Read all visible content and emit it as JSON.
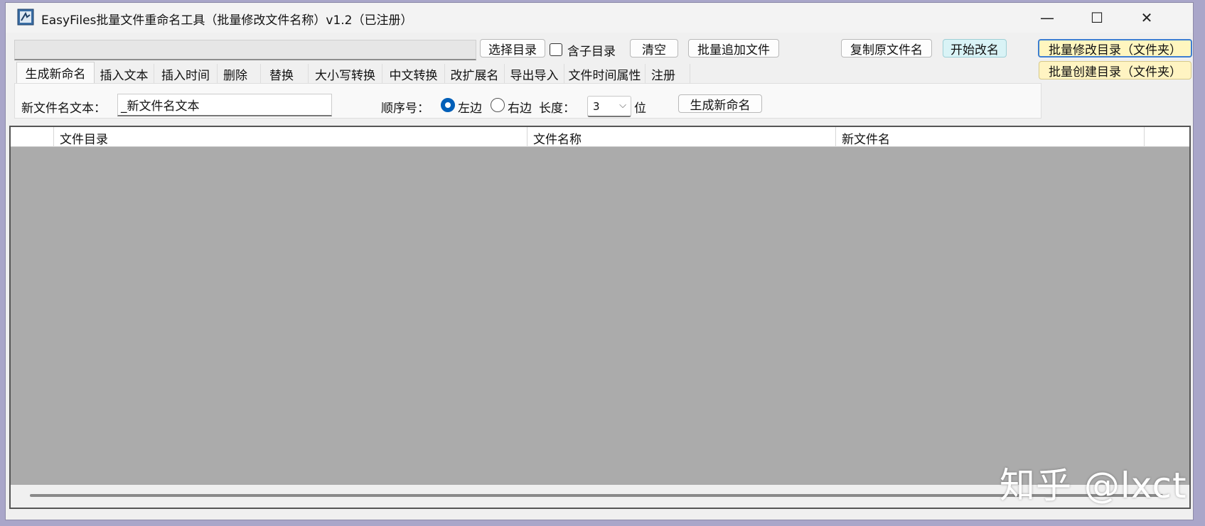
{
  "window": {
    "title": "EasyFiles批量文件重命名工具（批量修改文件名称）v1.2（已注册）",
    "minimize_glyph": "—",
    "maximize_glyph": "☐",
    "close_glyph": "✕"
  },
  "toolbar": {
    "path_value": "",
    "select_dir": "选择目录",
    "include_subdirs": "含子目录",
    "clear": "清空",
    "batch_add_files": "批量追加文件",
    "copy_original_names": "复制原文件名",
    "start_rename": "开始改名",
    "batch_modify_dirs": "批量修改目录（文件夹）",
    "batch_create_dirs": "批量创建目录（文件夹）"
  },
  "tabs": [
    {
      "label": "生成新命名",
      "active": true
    },
    {
      "label": "插入文本"
    },
    {
      "label": "插入时间"
    },
    {
      "label": "删除"
    },
    {
      "label": "替换"
    },
    {
      "label": "大小写转换"
    },
    {
      "label": "中文转换"
    },
    {
      "label": "改扩展名"
    },
    {
      "label": "导出导入"
    },
    {
      "label": "文件时间属性"
    },
    {
      "label": "注册"
    }
  ],
  "panel": {
    "new_name_label": "新文件名文本：",
    "new_name_value": "_新文件名文本",
    "sequence_label": "顺序号：",
    "left_option": "左边",
    "right_option": "右边",
    "length_label": "长度：",
    "length_value": "3",
    "unit": "位",
    "generate_button": "生成新命名"
  },
  "grid": {
    "columns": [
      "",
      "文件目录",
      "文件名称",
      "新文件名",
      ""
    ]
  },
  "watermark": "知乎 @lxct",
  "colors": {
    "desktop": "#a9a6c9",
    "start_rename_bg": "#d9f3f6",
    "batch_modify_bg": "#fff6bf",
    "batch_create_bg": "#fff4c2",
    "radio_accent": "#005fb8",
    "grid_bg": "#ababab"
  }
}
